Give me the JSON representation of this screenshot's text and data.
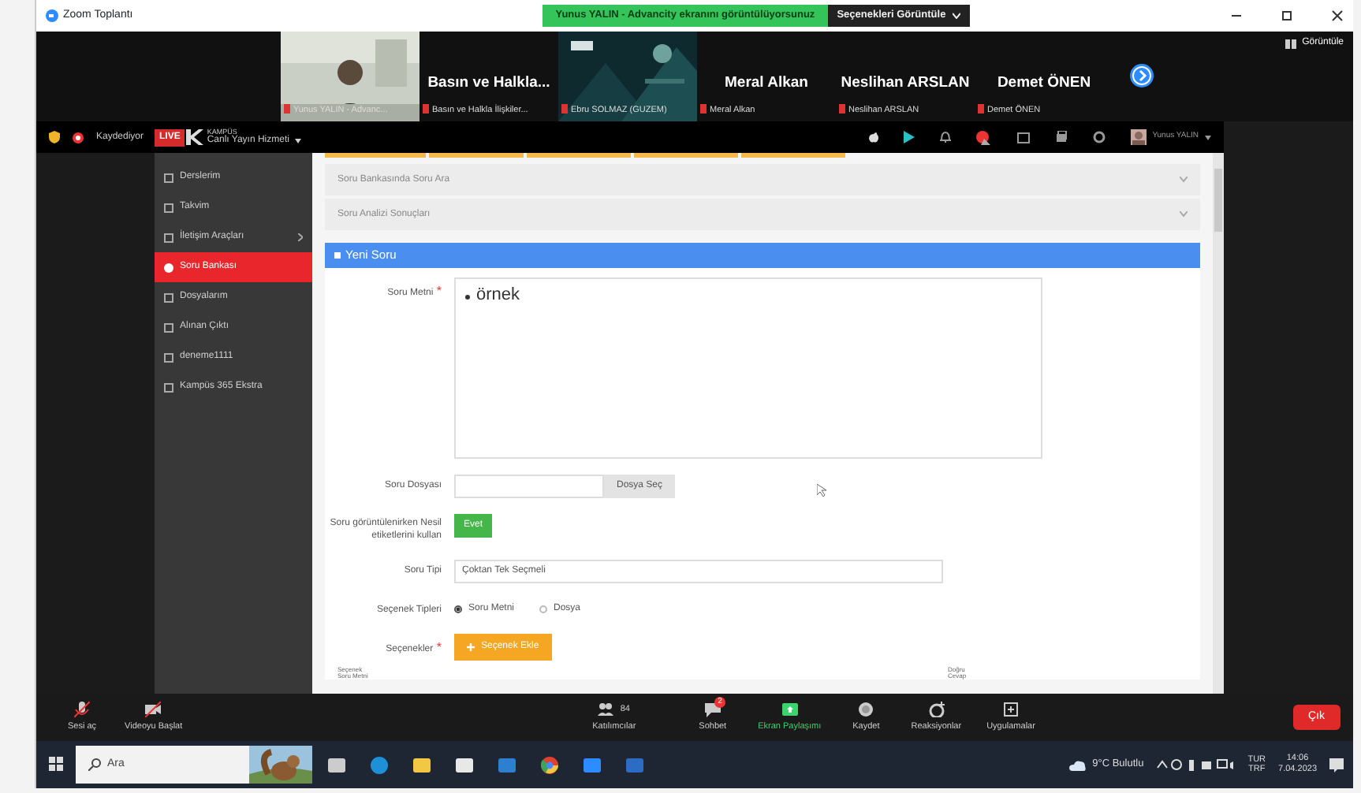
{
  "window": {
    "title": "Zoom Toplantı"
  },
  "share_banner": {
    "text": "Yunus YALIN - Advancity ekranını görüntülüyorsunuz",
    "button": "Seçenekleri Görüntüle"
  },
  "participants": [
    {
      "kind": "video",
      "caption": "Yunus YALIN - Advanc..."
    },
    {
      "kind": "name",
      "name": "Basın ve Halkla...",
      "caption": "Basın ve Halkla İlişkiler..."
    },
    {
      "kind": "video",
      "caption": "Ebru SOLMAZ (GUZEM)"
    },
    {
      "kind": "name",
      "name": "Meral Alkan",
      "caption": "Meral Alkan"
    },
    {
      "kind": "name",
      "name": "Neslihan ARSLAN",
      "caption": "Neslihan ARSLAN"
    },
    {
      "kind": "name",
      "name": "Demet ÖNEN",
      "caption": "Demet ÖNEN"
    }
  ],
  "view_button": "Görüntüle",
  "recording": "Kaydediyor",
  "shared_screen": {
    "live_tag": "LIVE",
    "logo": "KAMPÜS",
    "service": "Canlı Yayın Hizmeti",
    "user": "Yunus YALIN",
    "sidebar": [
      {
        "label": "Derslerim",
        "selected": false,
        "expandable": false
      },
      {
        "label": "Takvim",
        "selected": false,
        "expandable": false
      },
      {
        "label": "İletişim Araçları",
        "selected": false,
        "expandable": true
      },
      {
        "label": "Soru Bankası",
        "selected": true,
        "expandable": false
      },
      {
        "label": "Dosyalarım",
        "selected": false,
        "expandable": false
      },
      {
        "label": "Alınan Çıktı",
        "selected": false,
        "expandable": false
      },
      {
        "label": "deneme1111",
        "selected": false,
        "expandable": false
      },
      {
        "label": "Kampüs 365 Ekstra",
        "selected": false,
        "expandable": false
      }
    ],
    "panels": [
      "Soru Bankasında Soru Ara",
      "Soru Analizi Sonuçları"
    ],
    "form": {
      "title": "Yeni Soru",
      "question": {
        "label": "Soru Metni",
        "required_mark": "*",
        "value": "örnek"
      },
      "file": {
        "label": "Soru Dosyası",
        "button": "Dosya Seç"
      },
      "tags": {
        "label": "Soru görüntülenirken Nesil etiketlerini kullan",
        "toggle": "Evet",
        "on": true
      },
      "type": {
        "label": "Soru Tipi",
        "value": "Çoktan Tek Seçmeli"
      },
      "option_types": {
        "label": "Seçenek Tipleri",
        "items": [
          {
            "label": "Soru Metni",
            "selected": true
          },
          {
            "label": "Dosya",
            "selected": false
          }
        ]
      },
      "options": {
        "label": "Seçenekler",
        "required_mark": "*",
        "button": "Seçenek Ekle"
      },
      "columns": [
        "Seçenek Soru Metni",
        "Doğru Cevap"
      ]
    }
  },
  "toolbar": [
    {
      "kind": "mic",
      "label": "Sesi aç"
    },
    {
      "kind": "video",
      "label": "Videoyu Başlat"
    },
    {
      "kind": "people",
      "label": "Katılımcılar",
      "count": "84"
    },
    {
      "kind": "chat",
      "label": "Sohbet",
      "badge": "2"
    },
    {
      "kind": "share",
      "label": "Ekran Paylaşımı"
    },
    {
      "kind": "record",
      "label": "Kaydet"
    },
    {
      "kind": "react",
      "label": "Reaksiyonlar"
    },
    {
      "kind": "apps",
      "label": "Uygulamalar"
    }
  ],
  "leave_button": "Çık",
  "taskbar": {
    "search": "Ara",
    "weather": "9°C Bulutlu",
    "language": [
      "TUR",
      "TRF"
    ],
    "time": "14:06",
    "date": "7.04.2023"
  }
}
